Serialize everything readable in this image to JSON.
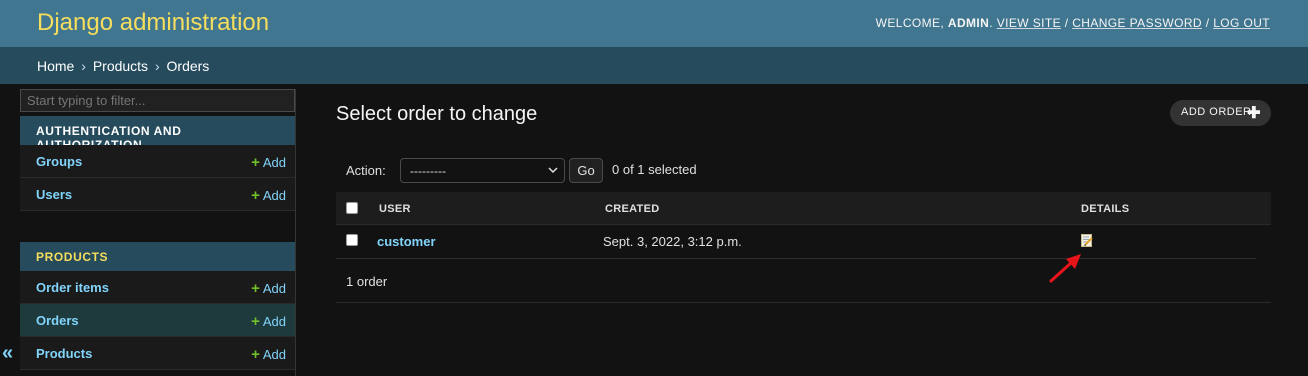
{
  "header": {
    "title": "Django administration",
    "welcome": "WELCOME,",
    "username": "ADMIN",
    "view_site": "VIEW SITE",
    "change_password": "CHANGE PASSWORD",
    "log_out": "LOG OUT",
    "separator": "/"
  },
  "breadcrumbs": {
    "home": "Home",
    "app": "Products",
    "current": "Orders",
    "separator": "›"
  },
  "sidebar": {
    "filter_placeholder": "Start typing to filter...",
    "apps": [
      {
        "caption": "AUTHENTICATION AND AUTHORIZATION",
        "models": [
          {
            "name": "Groups",
            "add_label": "Add"
          },
          {
            "name": "Users",
            "add_label": "Add"
          }
        ]
      },
      {
        "caption": "PRODUCTS",
        "models": [
          {
            "name": "Order items",
            "add_label": "Add"
          },
          {
            "name": "Orders",
            "add_label": "Add",
            "current": true
          },
          {
            "name": "Products",
            "add_label": "Add"
          }
        ]
      }
    ],
    "toggle_label": "«"
  },
  "content": {
    "title": "Select order to change",
    "add_button": "ADD ORDER",
    "add_icon": "plus-icon"
  },
  "actions": {
    "label": "Action:",
    "selected_option": "---------",
    "go_button": "Go",
    "selection_counter": "0 of 1 selected"
  },
  "table": {
    "columns": [
      "USER",
      "CREATED",
      "DETAILS"
    ],
    "rows": [
      {
        "user": "customer",
        "created": "Sept. 3, 2022, 3:12 p.m.",
        "details_icon": "edit-note-icon"
      }
    ]
  },
  "paginator": {
    "count_text": "1 order"
  },
  "colors": {
    "header_bg": "#417690",
    "branding": "#f5dd5d",
    "breadcrumbs_bg": "#264b5d",
    "link": "#81d4fa",
    "add_plus": "#70bf2b",
    "annotation_arrow": "#e8141b"
  }
}
